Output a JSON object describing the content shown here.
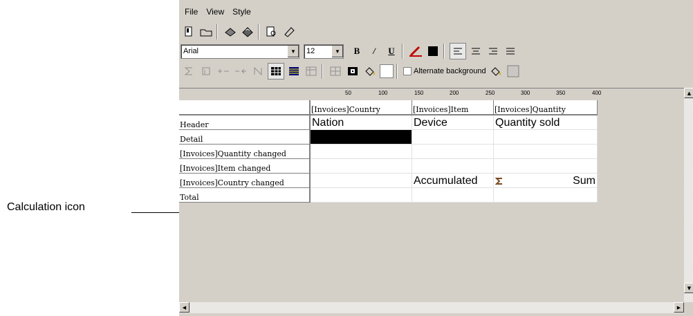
{
  "callout": {
    "label": "Calculation icon"
  },
  "menu": [
    "File",
    "View",
    "Style"
  ],
  "font": {
    "family": "Arial",
    "size": "12"
  },
  "toolbar3": {
    "alternate_label": "Alternate background"
  },
  "ruler": [
    "50",
    "100",
    "150",
    "200",
    "250",
    "300",
    "350",
    "400"
  ],
  "columns": [
    "[Invoices]Country",
    "[Invoices]Item",
    "[Invoices]Quantity"
  ],
  "rows": [
    {
      "label": "Header",
      "cells": [
        "Nation",
        "Device",
        "Quantity sold"
      ]
    },
    {
      "label": "Detail",
      "cells": [
        "",
        "",
        ""
      ]
    },
    {
      "label": "[Invoices]Quantity changed",
      "cells": [
        "",
        "",
        ""
      ]
    },
    {
      "label": "[Invoices]Item changed",
      "cells": [
        "",
        "",
        ""
      ]
    },
    {
      "label": "[Invoices]Country changed",
      "cells": [
        "",
        "Accumulated",
        "Sum"
      ]
    },
    {
      "label": "Total",
      "cells": [
        "",
        "",
        ""
      ]
    }
  ]
}
